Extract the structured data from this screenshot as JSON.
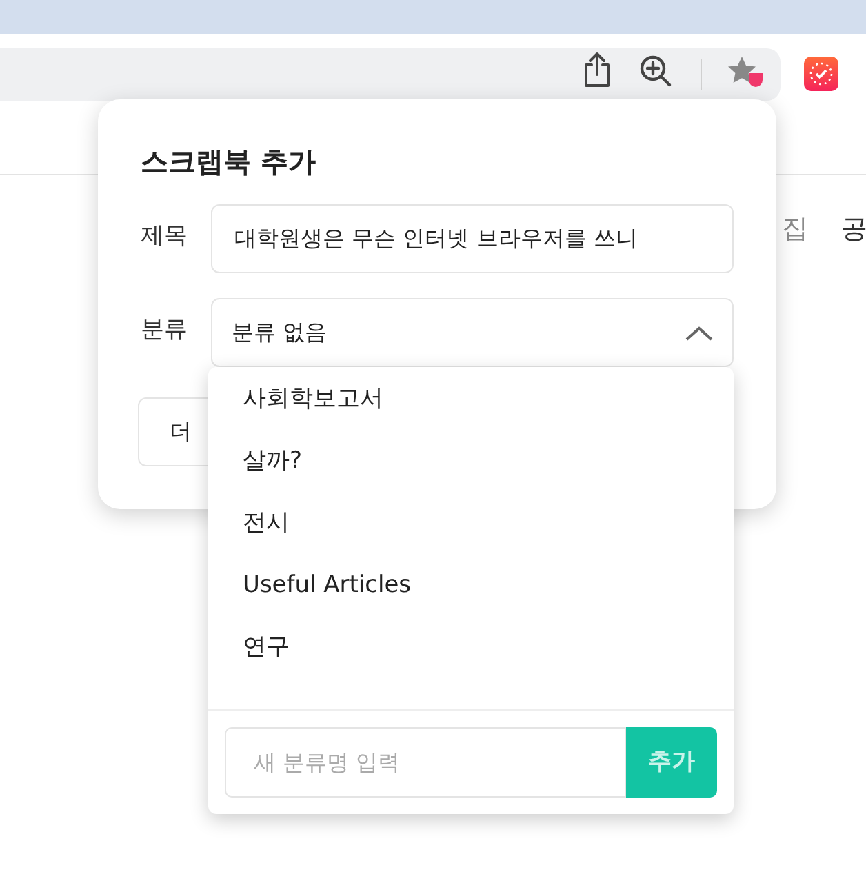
{
  "page_behind": {
    "texts": [
      "집",
      "공"
    ],
    "more_button": "더"
  },
  "scrap_popup": {
    "title": "스크랩북 추가",
    "title_label": "제목",
    "title_value": "대학원생은 무슨 인터넷 브라우저를 쓰니",
    "category_label": "분류",
    "category_value": "분류 없음",
    "expanded": true
  },
  "category_menu": {
    "items": [
      {
        "label": "사회학보고서"
      },
      {
        "label": "살까?"
      },
      {
        "label": "전시"
      },
      {
        "label": "Useful Articles"
      },
      {
        "label": "연구"
      }
    ],
    "new_category": {
      "placeholder": "새 분류명 입력",
      "button": "추가"
    }
  }
}
